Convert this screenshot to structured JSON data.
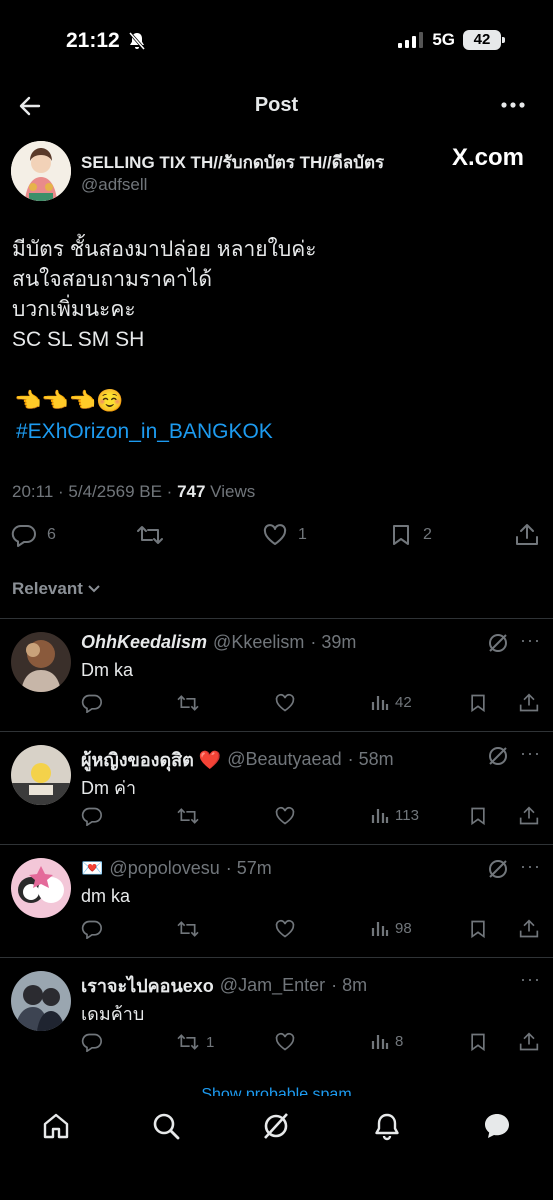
{
  "status": {
    "time": "21:12",
    "network": "5G",
    "battery": "42"
  },
  "header": {
    "title": "Post"
  },
  "post": {
    "author_name": "SELLING TIX TH//รับกดบัตร TH//ดีลบัตร",
    "author_handle": "@adfsell",
    "watermark": "X.com",
    "body": "มีบัตร ชั้นสองมาปล่อย หลายใบค่ะ\nสนใจสอบถามราคาได้\nบวกเพิ่มนะคะ\nSC SL SM SH",
    "emojis": "👈👈👈☺️",
    "hashtag": "#EXhOrizon_in_BANGKOK",
    "timestamp": "20:11 · 5/4/2569 BE · ",
    "views_count": "747",
    "views_label": " Views",
    "replies": "6",
    "likes": "1",
    "bookmarks": "2"
  },
  "sort": {
    "label": "Relevant"
  },
  "replies": [
    {
      "name": "OhhKeedalism",
      "handle": "@Kkeelism",
      "time": "· 39m",
      "text": "Dm ka",
      "retweets": "",
      "views": "42"
    },
    {
      "name": "ผู้หญิงของดุสิต ❤️",
      "handle": "@Beautyaead",
      "time": "· 58m",
      "text": "Dm ค่า",
      "retweets": "",
      "views": "113"
    },
    {
      "name": "💌",
      "handle": "@popolovesu",
      "time": "· 57m",
      "text": "dm ka",
      "retweets": "",
      "views": "98"
    },
    {
      "name": "เราจะไปคอนexo",
      "handle": "@Jam_Enter",
      "time": "· 8m",
      "text": "เดมค้าบ",
      "retweets": "1",
      "views": "8"
    }
  ],
  "footer": {
    "show_more": "Show probable spam"
  },
  "colors": {
    "accent": "#1d9bf0",
    "background": "#000000",
    "muted": "#71767b",
    "divider": "#2f3336"
  },
  "icons": [
    "back-arrow-icon",
    "more-icon",
    "reply-icon",
    "retweet-icon",
    "like-icon",
    "bookmark-icon",
    "share-icon",
    "views-icon",
    "grok-icon",
    "home-icon",
    "search-icon",
    "notifications-icon",
    "messages-icon"
  ]
}
